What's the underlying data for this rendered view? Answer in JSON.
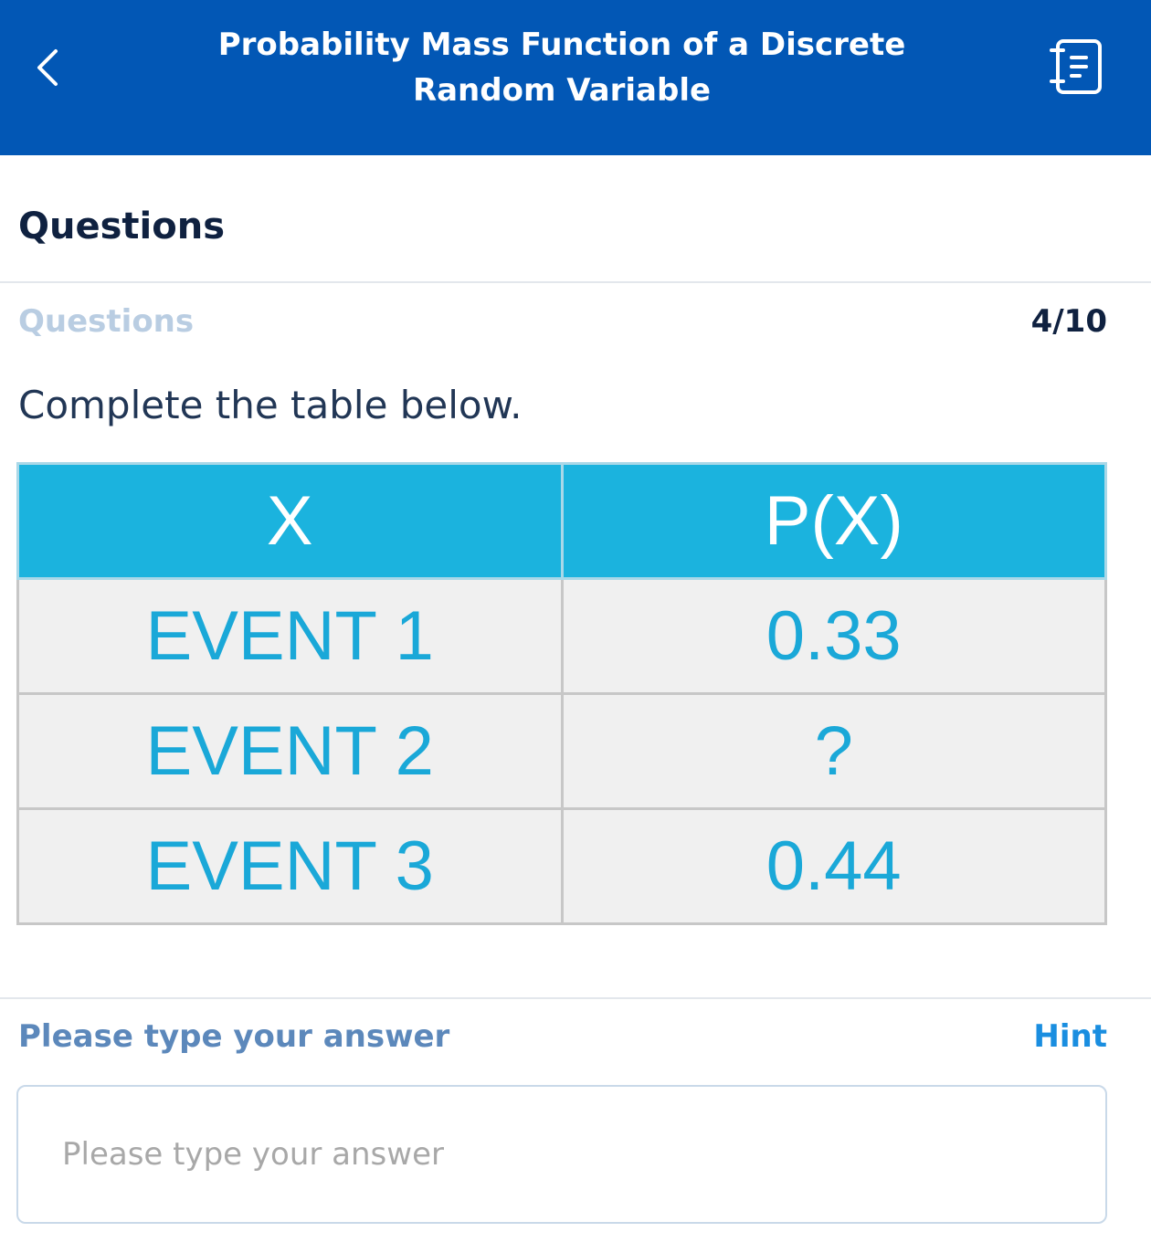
{
  "header": {
    "title": "Probability Mass Function of a Discrete Random Variable",
    "back_icon": "chevron-left-icon",
    "notes_icon": "notebook-icon",
    "background_color": "#0257b5"
  },
  "section": {
    "heading": "Questions"
  },
  "question": {
    "label": "Questions",
    "progress": "4/10",
    "prompt": "Complete the table below."
  },
  "table": {
    "headers": [
      "X",
      "P(X)"
    ],
    "rows": [
      [
        "EVENT 1",
        "0.33"
      ],
      [
        "EVENT 2",
        "?"
      ],
      [
        "EVENT 3",
        "0.44"
      ]
    ],
    "header_color": "#1bb3de",
    "cell_text_color": "#1aa8d8"
  },
  "answer": {
    "label": "Please type your answer",
    "hint": "Hint",
    "placeholder": "Please type your answer",
    "value": ""
  }
}
